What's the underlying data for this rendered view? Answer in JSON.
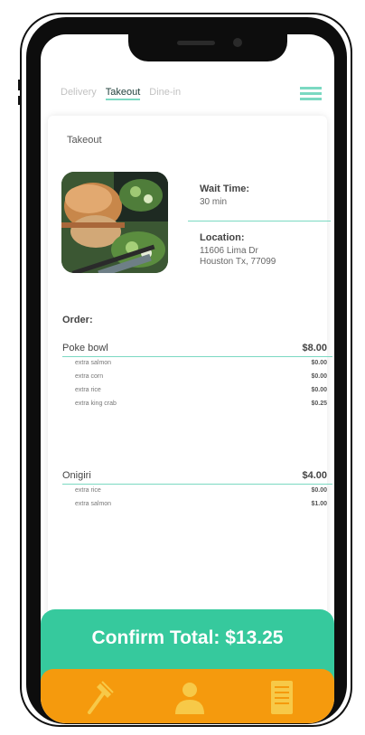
{
  "tabs": [
    {
      "label": "Delivery",
      "active": false
    },
    {
      "label": "Takeout",
      "active": true
    },
    {
      "label": "Dine-in",
      "active": false
    }
  ],
  "section_title": "Takeout",
  "wait": {
    "label": "Wait Time:",
    "value": "30 min"
  },
  "location": {
    "label": "Location:",
    "lines": [
      "11606 Lima Dr",
      "Houston Tx, 77099"
    ]
  },
  "order_label": "Order:",
  "order_items": [
    {
      "name": "Poke bowl",
      "price": "$8.00",
      "extras": [
        {
          "name": "extra salmon",
          "price": "$0.00"
        },
        {
          "name": "extra corn",
          "price": "$0.00"
        },
        {
          "name": "extra rice",
          "price": "$0.00"
        },
        {
          "name": "extra king crab",
          "price": "$0.25"
        }
      ]
    },
    {
      "name": "Onigiri",
      "price": "$4.00",
      "extras": [
        {
          "name": "extra rice",
          "price": "$0.00"
        },
        {
          "name": "extra salmon",
          "price": "$1.00"
        }
      ]
    }
  ],
  "confirm_label": "Confirm Total:  $13.25",
  "nav": [
    {
      "icon": "utensil-icon"
    },
    {
      "icon": "user-icon"
    },
    {
      "icon": "receipt-icon"
    }
  ],
  "colors": {
    "accent": "#7bd9c2",
    "confirm": "#36c99d",
    "nav": "#f59a0d"
  }
}
